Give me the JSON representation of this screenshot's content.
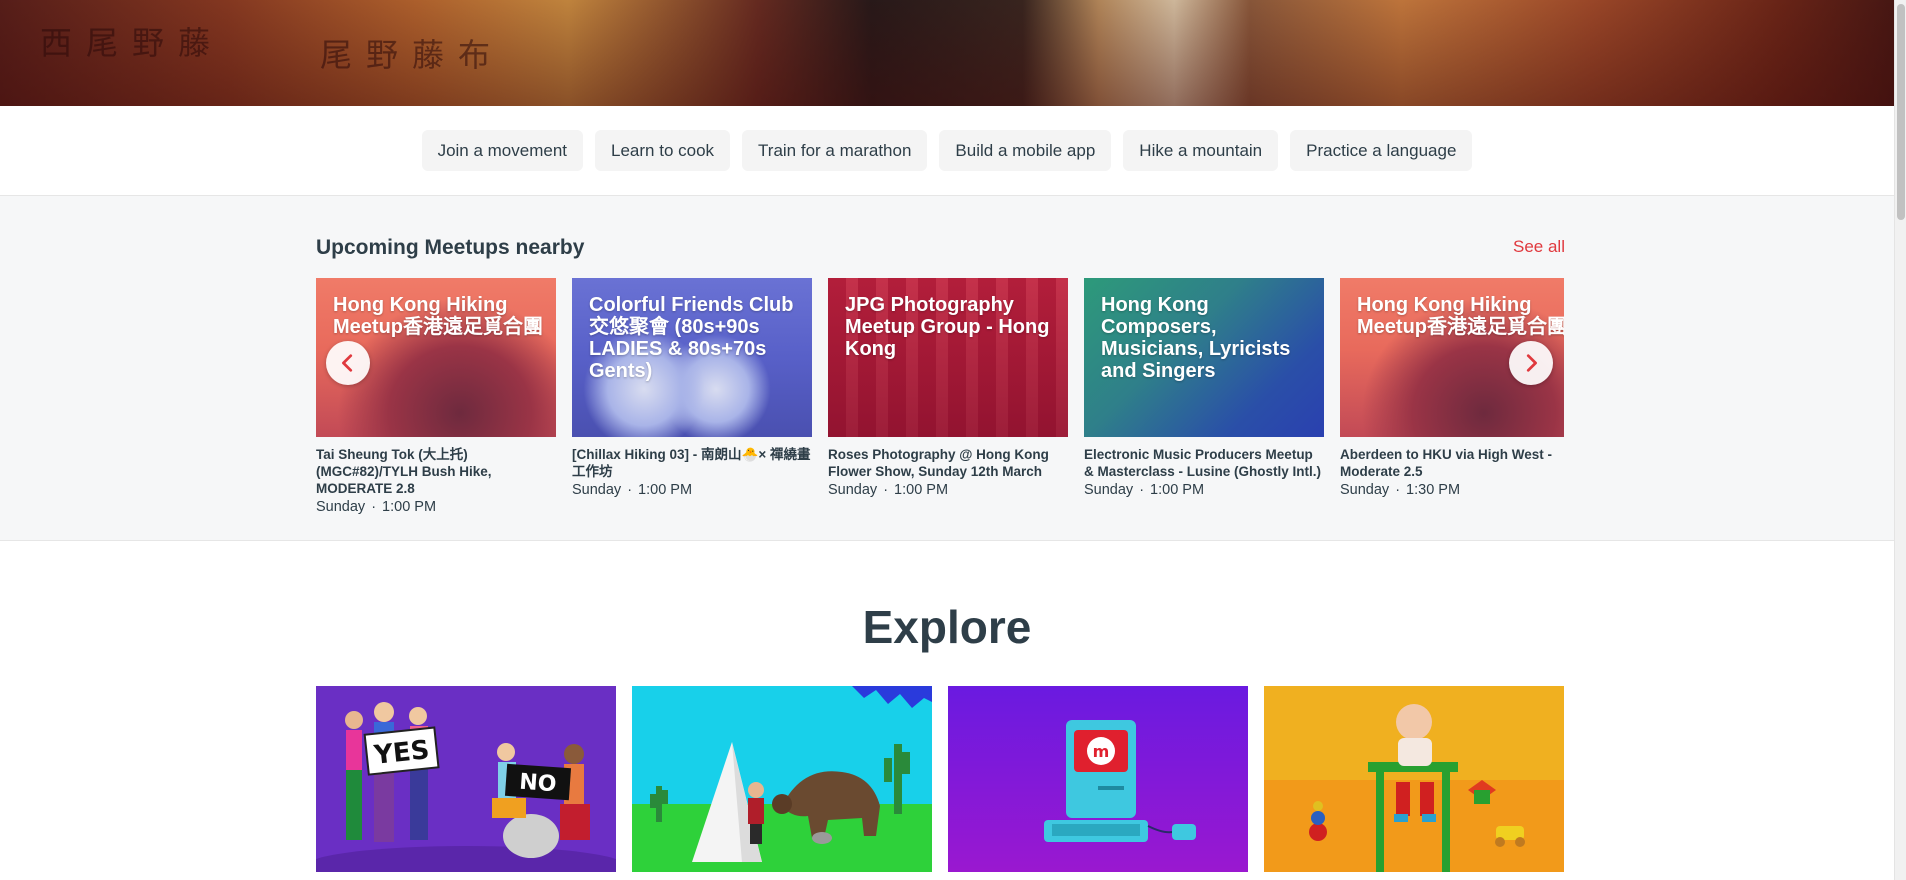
{
  "hero": {
    "decor_glyphs_left": "西尾野藤",
    "decor_glyphs_right": "尾野藤布"
  },
  "interests": [
    "Join a movement",
    "Learn to cook",
    "Train for a marathon",
    "Build a mobile app",
    "Hike a mountain",
    "Practice a language"
  ],
  "upcoming": {
    "title": "Upcoming Meetups nearby",
    "see_all": "See all",
    "cards": [
      {
        "group": "Hong Kong Hiking Meetup香港遠足覓合團",
        "title": "Tai Sheung Tok (大上托)(MGC#82)/TYLH Bush Hike, MODERATE 2.8",
        "day": "Sunday",
        "time": "1:00 PM"
      },
      {
        "group": "Colorful Friends Club 交悠聚會 (80s+90s LADIES & 80s+70s Gents)",
        "title": "[Chillax Hiking 03] - 南朗山🐣× 禪繞畫工作坊",
        "day": "Sunday",
        "time": "1:00 PM"
      },
      {
        "group": "JPG Photography Meetup Group - Hong Kong",
        "title": "Roses Photography @ Hong Kong Flower Show, Sunday 12th March",
        "day": "Sunday",
        "time": "1:00 PM"
      },
      {
        "group": "Hong Kong Composers, Musicians, Lyricists and Singers",
        "title": "Electronic Music Producers Meetup & Masterclass - Lusine (Ghostly Intl.)",
        "day": "Sunday",
        "time": "1:00 PM"
      },
      {
        "group": "Hong Kong Hiking Meetup香港遠足覓合團",
        "title": "Aberdeen to HKU via High West - Moderate 2.5",
        "day": "Sunday",
        "time": "1:30 PM"
      }
    ]
  },
  "explore": {
    "title": "Explore",
    "tiles": [
      {
        "sign_yes": "YES",
        "sign_no": "NO"
      },
      {
        "scene": "teepee-bear"
      },
      {
        "scene": "retro-computer"
      },
      {
        "scene": "baby-highchair"
      }
    ]
  },
  "colors": {
    "accent": "#e0393e",
    "text": "#2e3e48",
    "section_bg": "#f6f7f8",
    "chip_bg": "#f4f4f4"
  },
  "icons": [
    "chevron-left-icon",
    "chevron-right-icon"
  ]
}
